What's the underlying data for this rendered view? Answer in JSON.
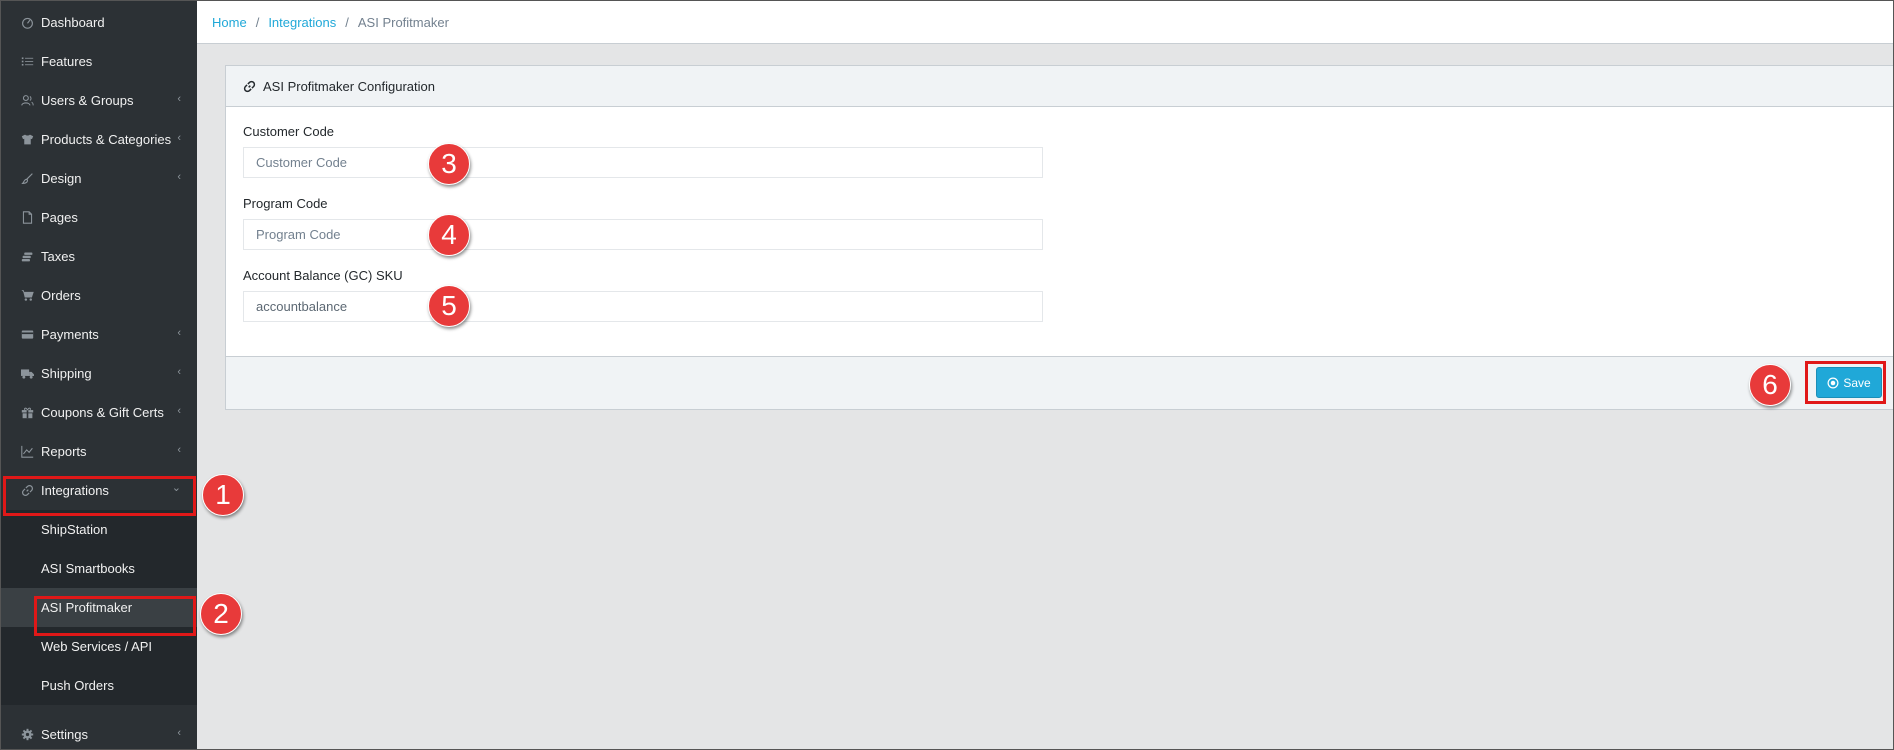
{
  "sidebar": {
    "items": [
      {
        "label": "Dashboard",
        "icon": "dashboard-icon",
        "caret": ""
      },
      {
        "label": "Features",
        "icon": "list-icon",
        "caret": ""
      },
      {
        "label": "Users & Groups",
        "icon": "users-icon",
        "caret": "‹"
      },
      {
        "label": "Products & Categories",
        "icon": "tshirt-icon",
        "caret": "‹"
      },
      {
        "label": "Design",
        "icon": "brush-icon",
        "caret": "‹"
      },
      {
        "label": "Pages",
        "icon": "page-icon",
        "caret": ""
      },
      {
        "label": "Taxes",
        "icon": "coins-icon",
        "caret": ""
      },
      {
        "label": "Orders",
        "icon": "cart-icon",
        "caret": ""
      },
      {
        "label": "Payments",
        "icon": "credit-card-icon",
        "caret": "‹"
      },
      {
        "label": "Shipping",
        "icon": "truck-icon",
        "caret": "‹"
      },
      {
        "label": "Coupons & Gift Certs",
        "icon": "gift-icon",
        "caret": "‹"
      },
      {
        "label": "Reports",
        "icon": "chart-icon",
        "caret": "‹"
      },
      {
        "label": "Integrations",
        "icon": "link-icon",
        "caret": "⌄"
      }
    ],
    "sub_items": [
      {
        "label": "ShipStation"
      },
      {
        "label": "ASI Smartbooks"
      },
      {
        "label": "ASI Profitmaker"
      },
      {
        "label": "Web Services / API"
      },
      {
        "label": "Push Orders"
      }
    ],
    "settings": {
      "label": "Settings",
      "icon": "gear-icon",
      "caret": "‹"
    }
  },
  "breadcrumb": {
    "home": "Home",
    "integrations": "Integrations",
    "current": "ASI Profitmaker",
    "separator": "/"
  },
  "card": {
    "title": "ASI Profitmaker Configuration",
    "fields": [
      {
        "label": "Customer Code",
        "placeholder": "Customer Code",
        "value": ""
      },
      {
        "label": "Program Code",
        "placeholder": "Program Code",
        "value": ""
      },
      {
        "label": "Account Balance (GC) SKU",
        "placeholder": "",
        "value": "accountbalance"
      }
    ],
    "save_label": "Save"
  },
  "annotations": [
    "1",
    "2",
    "3",
    "4",
    "5",
    "6"
  ],
  "colors": {
    "sidebar": "#2c3135",
    "accent": "#20a8d8",
    "annotation": "#e83a3a"
  }
}
